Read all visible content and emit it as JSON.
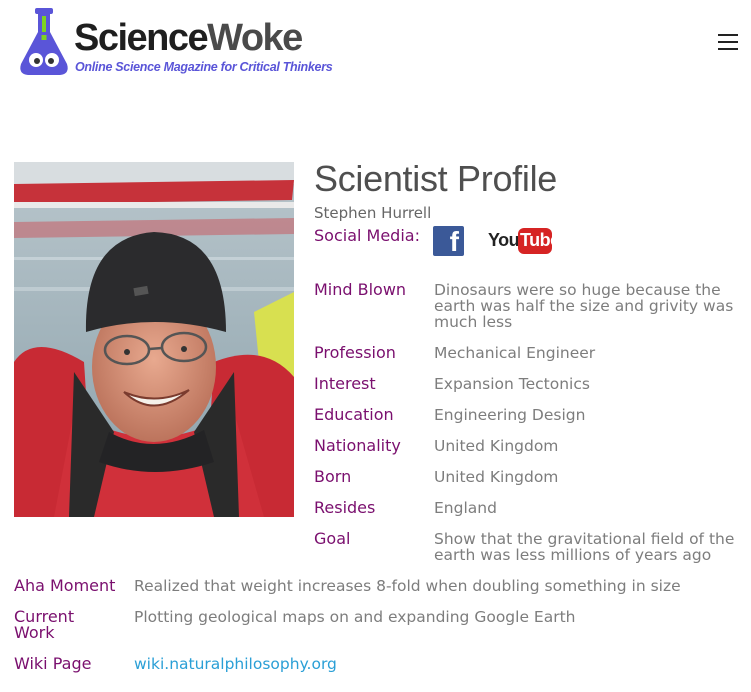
{
  "header": {
    "brand_part1": "Science",
    "brand_part2": "Woke",
    "tagline": "Online Science Magazine for Critical Thinkers",
    "menu_icon": "hamburger-menu-icon"
  },
  "profile": {
    "title": "Scientist Profile",
    "name": "Stephen Hurrell",
    "social_label": "Social Media:",
    "social": [
      {
        "icon": "facebook-icon",
        "text": "f"
      },
      {
        "icon": "youtube-icon",
        "text_you": "You",
        "text_tube": "Tube"
      }
    ],
    "fields": {
      "mind_blown": {
        "label": "Mind Blown",
        "value_lines": [
          "Dinosaurs were so huge because the",
          "earth was half the size and grivity was",
          "much less"
        ]
      },
      "profession": {
        "label": "Profession",
        "value": "Mechanical Engineer"
      },
      "interest": {
        "label": "Interest",
        "value": "Expansion Tectonics"
      },
      "education": {
        "label": "Education",
        "value": "Engineering Design"
      },
      "nationality": {
        "label": "Nationality",
        "value": "United Kingdom"
      },
      "born": {
        "label": "Born",
        "value": "United Kingdom"
      },
      "resides": {
        "label": "Resides",
        "value": "England"
      },
      "goal": {
        "label": "Goal",
        "value_lines": [
          "Show that the gravitational field of the",
          "earth was less millions of years ago"
        ]
      },
      "aha_moment": {
        "label": "Aha Moment",
        "value": "Realized that weight increases 8-fold when doubling something in size"
      },
      "current_work": {
        "label_lines": [
          "Current",
          "Work"
        ],
        "value": "Plotting geological maps on and expanding Google Earth"
      },
      "wiki_page": {
        "label": "Wiki Page",
        "value": "wiki.naturalphilosophy.org"
      }
    }
  },
  "colors": {
    "label": "#7a0f6e",
    "value": "#7d7d7d",
    "link": "#2a9fd6",
    "brand_tagline": "#5a55d8",
    "facebook": "#3b5998",
    "youtube": "#d62424"
  }
}
